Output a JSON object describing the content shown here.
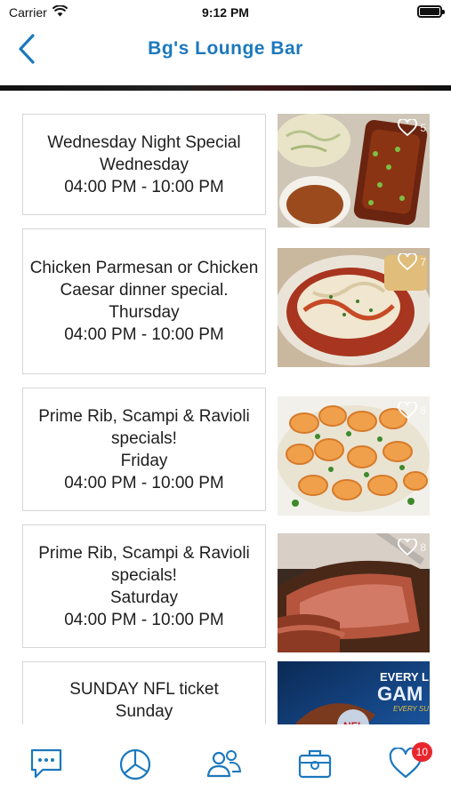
{
  "status_bar": {
    "carrier": "Carrier",
    "time": "9:12 PM"
  },
  "nav": {
    "title": "Bg's Lounge Bar"
  },
  "specials": [
    {
      "name": "Wednesday Night Special",
      "day": "Wednesday",
      "hours": "04:00 PM - 10:00 PM",
      "likes": "5"
    },
    {
      "name": "Chicken Parmesan or Chicken Caesar dinner special.",
      "day": "Thursday",
      "hours": "04:00 PM - 10:00 PM",
      "likes": "7"
    },
    {
      "name": "Prime Rib, Scampi & Ravioli specials!",
      "day": "Friday",
      "hours": "04:00 PM - 10:00 PM",
      "likes": "8"
    },
    {
      "name": "Prime Rib, Scampi & Ravioli specials!",
      "day": "Saturday",
      "hours": "04:00 PM - 10:00 PM",
      "likes": "8"
    },
    {
      "name": "SUNDAY NFL ticket",
      "day": "Sunday",
      "hours": "",
      "likes": "",
      "photo_text": "EVERY L GAM",
      "photo_subtext": "EVERY SU",
      "photo_logo": "NFL"
    }
  ],
  "tab_bar": {
    "items": [
      {
        "icon": "chat-bubble-icon"
      },
      {
        "icon": "pie-chart-icon"
      },
      {
        "icon": "people-icon"
      },
      {
        "icon": "briefcase-icon"
      },
      {
        "icon": "heart-icon",
        "badge": "10"
      }
    ]
  },
  "colors": {
    "accent": "#1c78bd",
    "badge": "#e8262c",
    "card_border": "#d6d6d6"
  }
}
